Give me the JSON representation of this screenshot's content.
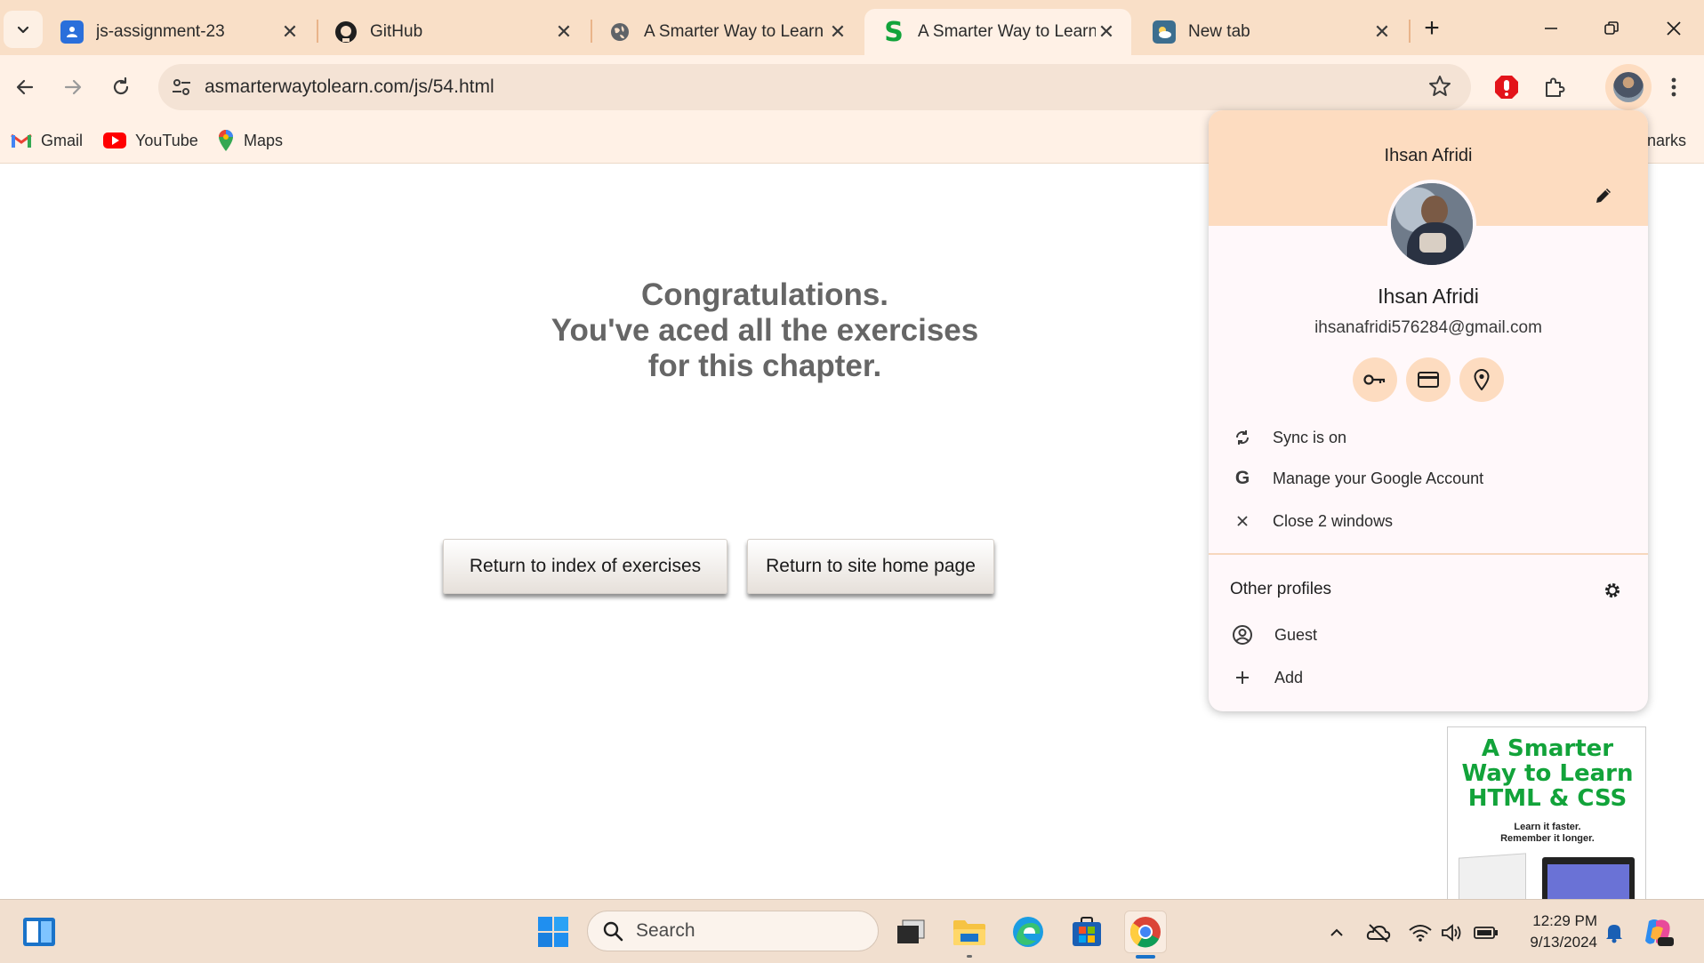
{
  "browser": {
    "tabs": [
      {
        "title": "js-assignment-23",
        "favicon": "classroom-icon",
        "active": false
      },
      {
        "title": "GitHub",
        "favicon": "github-icon",
        "active": false
      },
      {
        "title": "A Smarter Way to Learn J",
        "favicon": "globe-icon",
        "active": false
      },
      {
        "title": "A Smarter Way to Learn J",
        "favicon": "smarter-way-s-icon",
        "active": true
      },
      {
        "title": "New tab",
        "favicon": "weather-icon",
        "active": false
      }
    ],
    "tab_close_glyph": "✕",
    "new_tab_glyph": "+",
    "url": "asmarterwaytolearn.com/js/54.html",
    "bookmarks": [
      {
        "label": "Gmail",
        "icon": "gmail-icon"
      },
      {
        "label": "YouTube",
        "icon": "youtube-icon"
      },
      {
        "label": "Maps",
        "icon": "maps-icon"
      }
    ],
    "bookmarks_overflow_partial": "narks"
  },
  "page": {
    "congrats_lines": [
      "Congratulations.",
      "You've aced all the exercises",
      "for this chapter."
    ],
    "buttons": {
      "index": "Return to index of exercises",
      "home": "Return to site home page"
    },
    "ad": {
      "title_lines": [
        "A Smarter",
        "Way to Learn",
        "HTML & CSS"
      ],
      "tagline_lines": [
        "Learn it faster.",
        "Remember it longer."
      ],
      "accent": "#12a33a"
    }
  },
  "profile_menu": {
    "header_name": "Ihsan Afridi",
    "name": "Ihsan Afridi",
    "email": "ihsanafridi576284@gmail.com",
    "quick_actions": [
      "password-key-icon",
      "payment-card-icon",
      "location-pin-icon"
    ],
    "items": [
      {
        "label": "Sync is on",
        "icon": "sync-icon"
      },
      {
        "label": "Manage your Google Account",
        "icon": "google-g-icon"
      },
      {
        "label": "Close 2 windows",
        "icon": "close-icon"
      }
    ],
    "other_profiles_title": "Other profiles",
    "other_items": [
      {
        "label": "Guest",
        "icon": "guest-icon"
      },
      {
        "label": "Add",
        "icon": "add-icon"
      }
    ],
    "header_color": "#fddcc0"
  },
  "taskbar": {
    "search_placeholder": "Search",
    "time": "12:29 PM",
    "date": "9/13/2024"
  }
}
